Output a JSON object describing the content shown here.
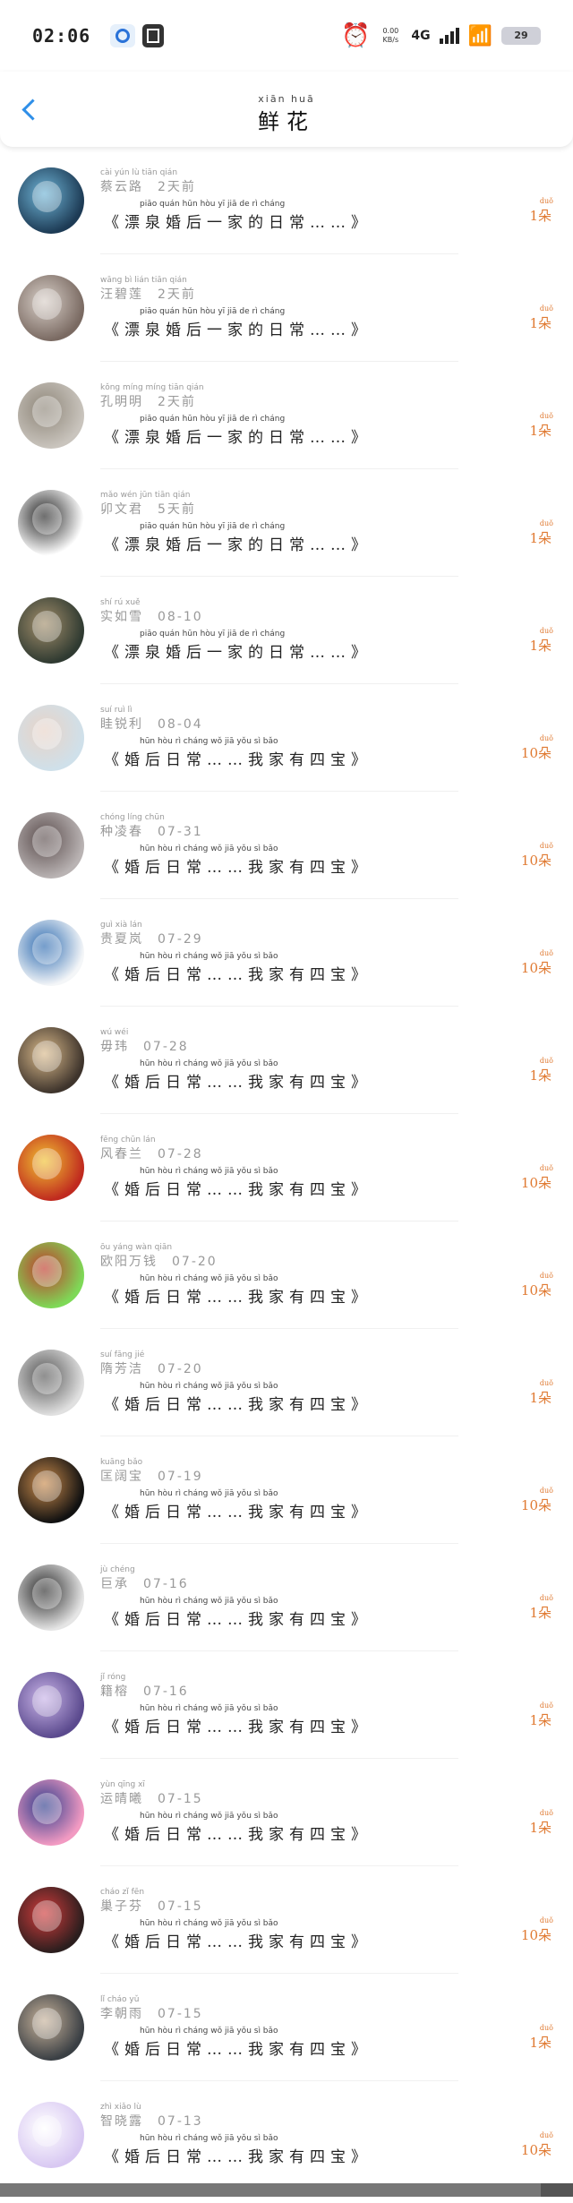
{
  "status_bar": {
    "time": "02:06",
    "speed_value": "0.00",
    "speed_unit": "KB/s",
    "network": "4G",
    "battery": "29"
  },
  "nav": {
    "title_pinyin": "xiān huā",
    "title": "鲜花"
  },
  "post_a": {
    "pinyin": "piāo quán  hūn hòu  yī  jiā  de  rì cháng",
    "title": "《漂泉婚后一家的日常……》"
  },
  "post_b": {
    "pinyin": "hūn hòu  rì cháng     wǒ  jiā  yǒu  sì  bǎo",
    "title": "《婚后日常……我家有四宝》"
  },
  "items": [
    {
      "name_pinyin": "cài  yún  lù   tiān qián",
      "name": "蔡云路",
      "date": "2天前",
      "count": "1朵",
      "count_pinyin": "duǒ",
      "avatar": "#1d3b55",
      "avatar2": "#6fb4d6",
      "post": "a"
    },
    {
      "name_pinyin": "wāng bì  lián   tiān qián",
      "name": "汪碧莲",
      "date": "2天前",
      "count": "1朵",
      "count_pinyin": "duǒ",
      "avatar": "#7a6a62",
      "avatar2": "#d8cfc8",
      "post": "a"
    },
    {
      "name_pinyin": "kǒng míng míng   tiān qián",
      "name": "孔明明",
      "date": "2天前",
      "count": "1朵",
      "count_pinyin": "duǒ",
      "avatar": "#c9c4bd",
      "avatar2": "#8e8679",
      "post": "a"
    },
    {
      "name_pinyin": "mǎo  wén  jūn   tiān qián",
      "name": "卯文君",
      "date": "5天前",
      "count": "1朵",
      "count_pinyin": "duǒ",
      "avatar": "#ffffff",
      "avatar2": "#222222",
      "post": "a"
    },
    {
      "name_pinyin": "shí  rú  xuě",
      "name": "实如雪",
      "date": "08-10",
      "count": "1朵",
      "count_pinyin": "duǒ",
      "avatar": "#2f3a31",
      "avatar2": "#a28e6b",
      "post": "a"
    },
    {
      "name_pinyin": "suí  ruì  lì",
      "name": "眭锐利",
      "date": "08-04",
      "count": "10朵",
      "count_pinyin": "duǒ",
      "avatar": "#cfe0ea",
      "avatar2": "#e8d3c7",
      "post": "b"
    },
    {
      "name_pinyin": "chóng líng chūn",
      "name": "种凌春",
      "date": "07-31",
      "count": "10朵",
      "count_pinyin": "duǒ",
      "avatar": "#b9b3b3",
      "avatar2": "#5b4d4d",
      "post": "b"
    },
    {
      "name_pinyin": "guì  xià  lán",
      "name": "贵夏岚",
      "date": "07-29",
      "count": "10朵",
      "count_pinyin": "duǒ",
      "avatar": "#f4f6f8",
      "avatar2": "#2c6ab0",
      "post": "b"
    },
    {
      "name_pinyin": "wú  wéi",
      "name": "毋玮",
      "date": "07-28",
      "count": "1朵",
      "count_pinyin": "duǒ",
      "avatar": "#3e342c",
      "avatar2": "#d9b98a",
      "post": "b"
    },
    {
      "name_pinyin": "fēng chūn lán",
      "name": "风春兰",
      "date": "07-28",
      "count": "10朵",
      "count_pinyin": "duǒ",
      "avatar": "#c02a1f",
      "avatar2": "#f1c232",
      "post": "b"
    },
    {
      "name_pinyin": "ōu yáng wàn qiān",
      "name": "欧阳万钱",
      "date": "07-20",
      "count": "10朵",
      "count_pinyin": "duǒ",
      "avatar": "#7ed957",
      "avatar2": "#c0392b",
      "post": "b"
    },
    {
      "name_pinyin": "suí fāng jié",
      "name": "隋芳洁",
      "date": "07-20",
      "count": "1朵",
      "count_pinyin": "duǒ",
      "avatar": "#e0e0e0",
      "avatar2": "#555555",
      "post": "b"
    },
    {
      "name_pinyin": "kuāng bǎo",
      "name": "匡阔宝",
      "date": "07-19",
      "count": "10朵",
      "count_pinyin": "duǒ",
      "avatar": "#111111",
      "avatar2": "#c98a4b",
      "post": "b"
    },
    {
      "name_pinyin": "jù  chéng",
      "name": "巨承",
      "date": "07-16",
      "count": "1朵",
      "count_pinyin": "duǒ",
      "avatar": "#e5e5e5",
      "avatar2": "#2a2a2a",
      "post": "b"
    },
    {
      "name_pinyin": "jǐ  róng",
      "name": "籍榕",
      "date": "07-16",
      "count": "1朵",
      "count_pinyin": "duǒ",
      "avatar": "#5b4a8e",
      "avatar2": "#c9b4e8",
      "post": "b"
    },
    {
      "name_pinyin": "yùn qīng  xī",
      "name": "运晴曦",
      "date": "07-15",
      "count": "1朵",
      "count_pinyin": "duǒ",
      "avatar": "#f29ac2",
      "avatar2": "#2d3c8c",
      "post": "b"
    },
    {
      "name_pinyin": "cháo  zǐ  fēn",
      "name": "巢子芬",
      "date": "07-15",
      "count": "10朵",
      "count_pinyin": "duǒ",
      "avatar": "#2b1e1e",
      "avatar2": "#d13b3b",
      "post": "b"
    },
    {
      "name_pinyin": "lǐ  cháo  yǔ",
      "name": "李朝雨",
      "date": "07-15",
      "count": "1朵",
      "count_pinyin": "duǒ",
      "avatar": "#3a3f44",
      "avatar2": "#c7b29a",
      "post": "b"
    },
    {
      "name_pinyin": "zhì  xiǎo  lù",
      "name": "智晓露",
      "date": "07-13",
      "count": "10朵",
      "count_pinyin": "duǒ",
      "avatar": "#d8c8f2",
      "avatar2": "#ffffff",
      "post": "b"
    }
  ]
}
